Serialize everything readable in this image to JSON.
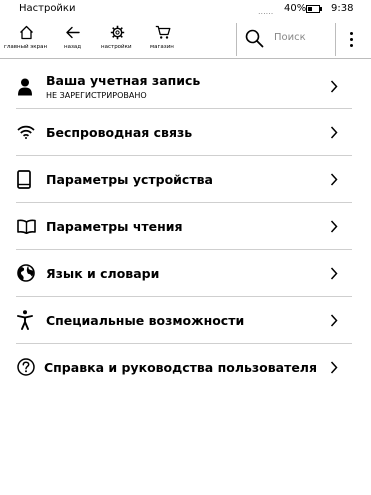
{
  "status_bar": {
    "title": "Настройки",
    "signal_dots": "......",
    "battery_percent": "40%",
    "battery_level": 0.4,
    "time": "9:38"
  },
  "toolbar": {
    "home_label": "главный экран",
    "back_label": "назад",
    "settings_label": "настройки",
    "store_label": "магазин",
    "search_placeholder": "Поиск"
  },
  "settings": {
    "account_title": "Ваша учетная запись",
    "account_status": "НЕ ЗАРЕГИСТРИРОВАНО",
    "wireless": "Беспроводная связь",
    "device": "Параметры устройства",
    "reading": "Параметры чтения",
    "language": "Язык и словари",
    "accessibility": "Специальные возможности",
    "help": "Справка и руководства пользователя"
  },
  "icons": {
    "account": "person-icon",
    "wireless": "wifi-icon",
    "device": "device-icon",
    "reading": "book-icon",
    "language": "globe-icon",
    "accessibility": "accessibility-icon",
    "help": "question-circle-icon",
    "row_arrow": "chevron-right-icon"
  }
}
